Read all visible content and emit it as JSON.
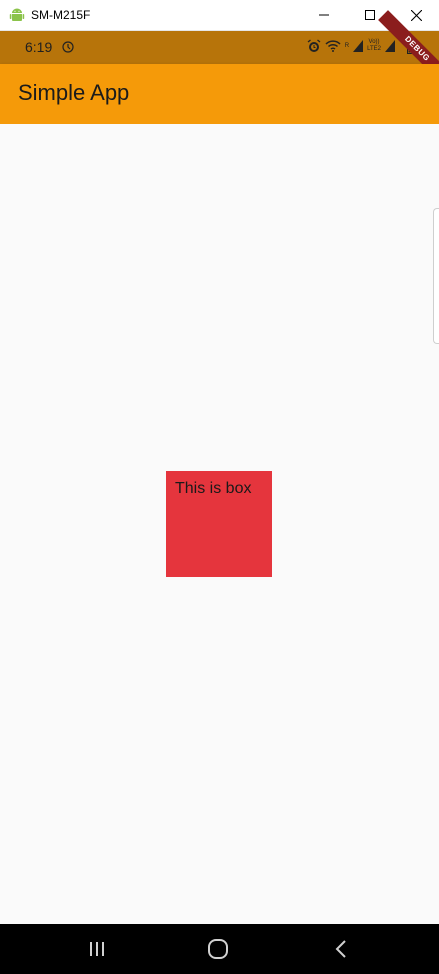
{
  "window": {
    "title": "SM-M215F",
    "icons": [
      "android-icon",
      "minimize-icon",
      "maximize-icon",
      "close-icon"
    ]
  },
  "status_bar": {
    "time": "6:19",
    "network_label_top": "Vo))",
    "network_label_bottom": "LTE2",
    "signal_label": "R",
    "background": "#b7740a"
  },
  "debug_banner": {
    "label": "DEBUG"
  },
  "app_bar": {
    "title": "Simple App",
    "background": "#f59a09"
  },
  "content": {
    "box_text": "This is box",
    "box_color": "#e5353d"
  },
  "nav_bar": {
    "icons": [
      "recents-icon",
      "home-icon",
      "back-icon"
    ]
  }
}
